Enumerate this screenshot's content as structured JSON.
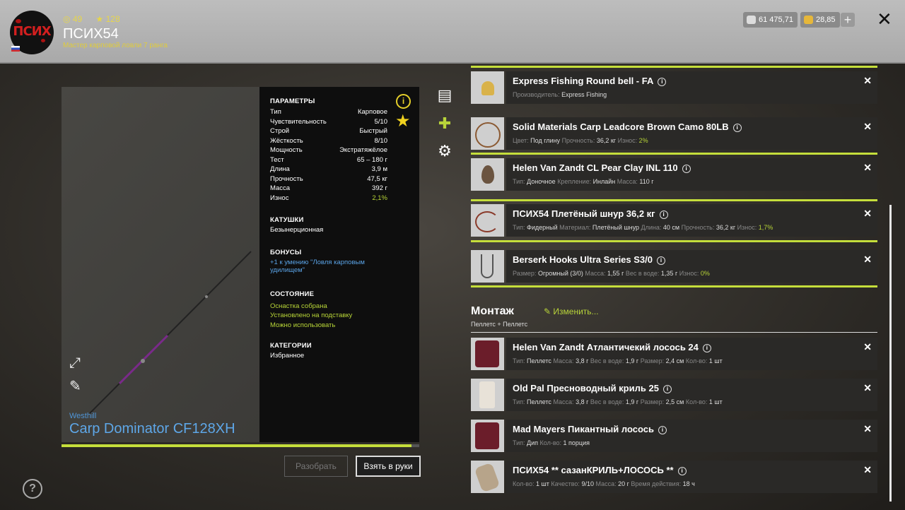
{
  "header": {
    "logo_text": "ПСИХ",
    "stat_level": "49",
    "stat_stars": "128",
    "username": "ПСИХ54",
    "rank": "Мастер карповой ловли 7 ранга",
    "silver": "61 475,71",
    "gold": "28,85",
    "plus_label": "+",
    "close_label": "✕"
  },
  "rod": {
    "brand": "Westhill",
    "name": "Carp Dominator CF128XH",
    "wear_progress": 0.979
  },
  "params": {
    "title": "ПАРАМЕТРЫ",
    "rows": [
      {
        "k": "Тип",
        "v": "Карповое"
      },
      {
        "k": "Чувствительность",
        "v": "5/10"
      },
      {
        "k": "Строй",
        "v": "Быстрый"
      },
      {
        "k": "Жёсткость",
        "v": "8/10"
      },
      {
        "k": "Мощность",
        "v": "Экстратяжёлое"
      },
      {
        "k": "Тест",
        "v": "65 – 180 г"
      },
      {
        "k": "Длина",
        "v": "3,9 м"
      },
      {
        "k": "Прочность",
        "v": "47,5 кг"
      },
      {
        "k": "Масса",
        "v": "392 г"
      },
      {
        "k": "Износ",
        "v": "2,1%"
      }
    ],
    "reels_title": "КАТУШКИ",
    "reels_value": "Безынерционная",
    "bonus_title": "БОНУСЫ",
    "bonus_line1": "+1 к умению \"Ловля карповым",
    "bonus_line2": "удилищем\"",
    "state_title": "СОСТОЯНИЕ",
    "state_1": "Оснастка собрана",
    "state_2": "Установлено на подставку",
    "state_3": "Можно использовать",
    "cat_title": "КАТЕГОРИИ",
    "cat_value": "Избранное"
  },
  "buttons": {
    "disassemble": "Разобрать",
    "take": "Взять в руки"
  },
  "tackle": [
    {
      "name": "Express Fishing Round bell - FA",
      "d": [
        [
          "Производитель: ",
          "Express Fishing"
        ]
      ]
    },
    {
      "name": "Solid Materials Carp Leadcore Brown Camo 80LB",
      "d": [
        [
          "Цвет: ",
          "Под глину"
        ],
        [
          "Прочность: ",
          "36,2 кг"
        ],
        [
          "Износ: ",
          "2%"
        ]
      ]
    },
    {
      "name": "Helen Van Zandt CL Pear Clay INL 110",
      "d": [
        [
          "Тип: ",
          "Доночное"
        ],
        [
          "Крепление: ",
          "Инлайн"
        ],
        [
          "Масса: ",
          "110 г"
        ]
      ]
    },
    {
      "name": "ПСИХ54 Плетёный шнур 36,2 кг",
      "d": [
        [
          "Тип: ",
          "Фидерный"
        ],
        [
          "Материал: ",
          "Плетёный шнур"
        ],
        [
          "Длина: ",
          "40 см"
        ],
        [
          "Прочность: ",
          "36,2 кг"
        ],
        [
          "Износ: ",
          "1,7%"
        ]
      ]
    },
    {
      "name": "Berserk Hooks Ultra Series S3/0",
      "d": [
        [
          "Размер: ",
          "Огромный (3/0)"
        ],
        [
          "Масса: ",
          "1,55 г"
        ],
        [
          "Вес в воде: ",
          "1,35 г"
        ],
        [
          "Износ: ",
          "0%"
        ]
      ]
    }
  ],
  "montage": {
    "title": "Монтаж",
    "edit": "Изменить...",
    "subtitle": "Пеллетс + Пеллетс"
  },
  "baits": [
    {
      "name": "Helen Van Zandt Атлантичекий лосось 24",
      "d": [
        [
          "Тип: ",
          "Пеллетс"
        ],
        [
          "Масса: ",
          "3,8 г"
        ],
        [
          "Вес в воде: ",
          "1,9 г"
        ],
        [
          "Размер: ",
          "2,4 см"
        ],
        [
          "Кол-во: ",
          "1 шт"
        ]
      ]
    },
    {
      "name": "Old Pal Пресноводный криль 25",
      "d": [
        [
          "Тип: ",
          "Пеллетс"
        ],
        [
          "Масса: ",
          "3,8 г"
        ],
        [
          "Вес в воде: ",
          "1,9 г"
        ],
        [
          "Размер: ",
          "2,5 см"
        ],
        [
          "Кол-во: ",
          "1 шт"
        ]
      ]
    },
    {
      "name": "Mad Mayers Пикантный лосось",
      "d": [
        [
          "Тип: ",
          "Дип"
        ],
        [
          "Кол-во: ",
          "1 порция"
        ]
      ]
    },
    {
      "name": "ПСИХ54 ** сазанКРИЛЬ+ЛОСОСЬ **",
      "d": [
        [
          "Кол-во: ",
          "1 шт"
        ],
        [
          "Качество: ",
          "9/10"
        ],
        [
          "Масса: ",
          "20 г"
        ],
        [
          "Время действия: ",
          "18 ч"
        ]
      ]
    }
  ],
  "colors": {
    "accent": "#c5de3b",
    "blue": "#5ea7e8",
    "star": "#f1d21f"
  }
}
